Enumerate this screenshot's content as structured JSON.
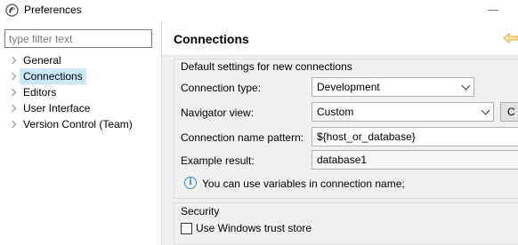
{
  "window": {
    "title": "Preferences"
  },
  "left_pane": {
    "filter_placeholder": "type filter text",
    "tree": [
      {
        "label": "General"
      },
      {
        "label": "Connections",
        "selected": true
      },
      {
        "label": "Editors"
      },
      {
        "label": "User Interface"
      },
      {
        "label": "Version Control (Team)"
      }
    ]
  },
  "page": {
    "title": "Connections",
    "defaults_group": {
      "title": "Default settings for new connections",
      "connection_type_label": "Connection type:",
      "connection_type_value": "Development",
      "navigator_view_label": "Navigator view:",
      "navigator_view_value": "Custom",
      "navigator_view_button": "C",
      "name_pattern_label": "Connection name pattern:",
      "name_pattern_value": "${host_or_database}",
      "example_result_label": "Example result:",
      "example_result_value": "database1",
      "info_text": "You can use variables in connection name;"
    },
    "security_group": {
      "title": "Security",
      "trust_store_label": "Use Windows trust store",
      "trust_store_checked": false
    }
  },
  "colors": {
    "selection": "#cce8ff",
    "panel_background": "#f0f0f0",
    "info_blue": "#3b8fd6",
    "back_arrow": "#e8a53a"
  }
}
